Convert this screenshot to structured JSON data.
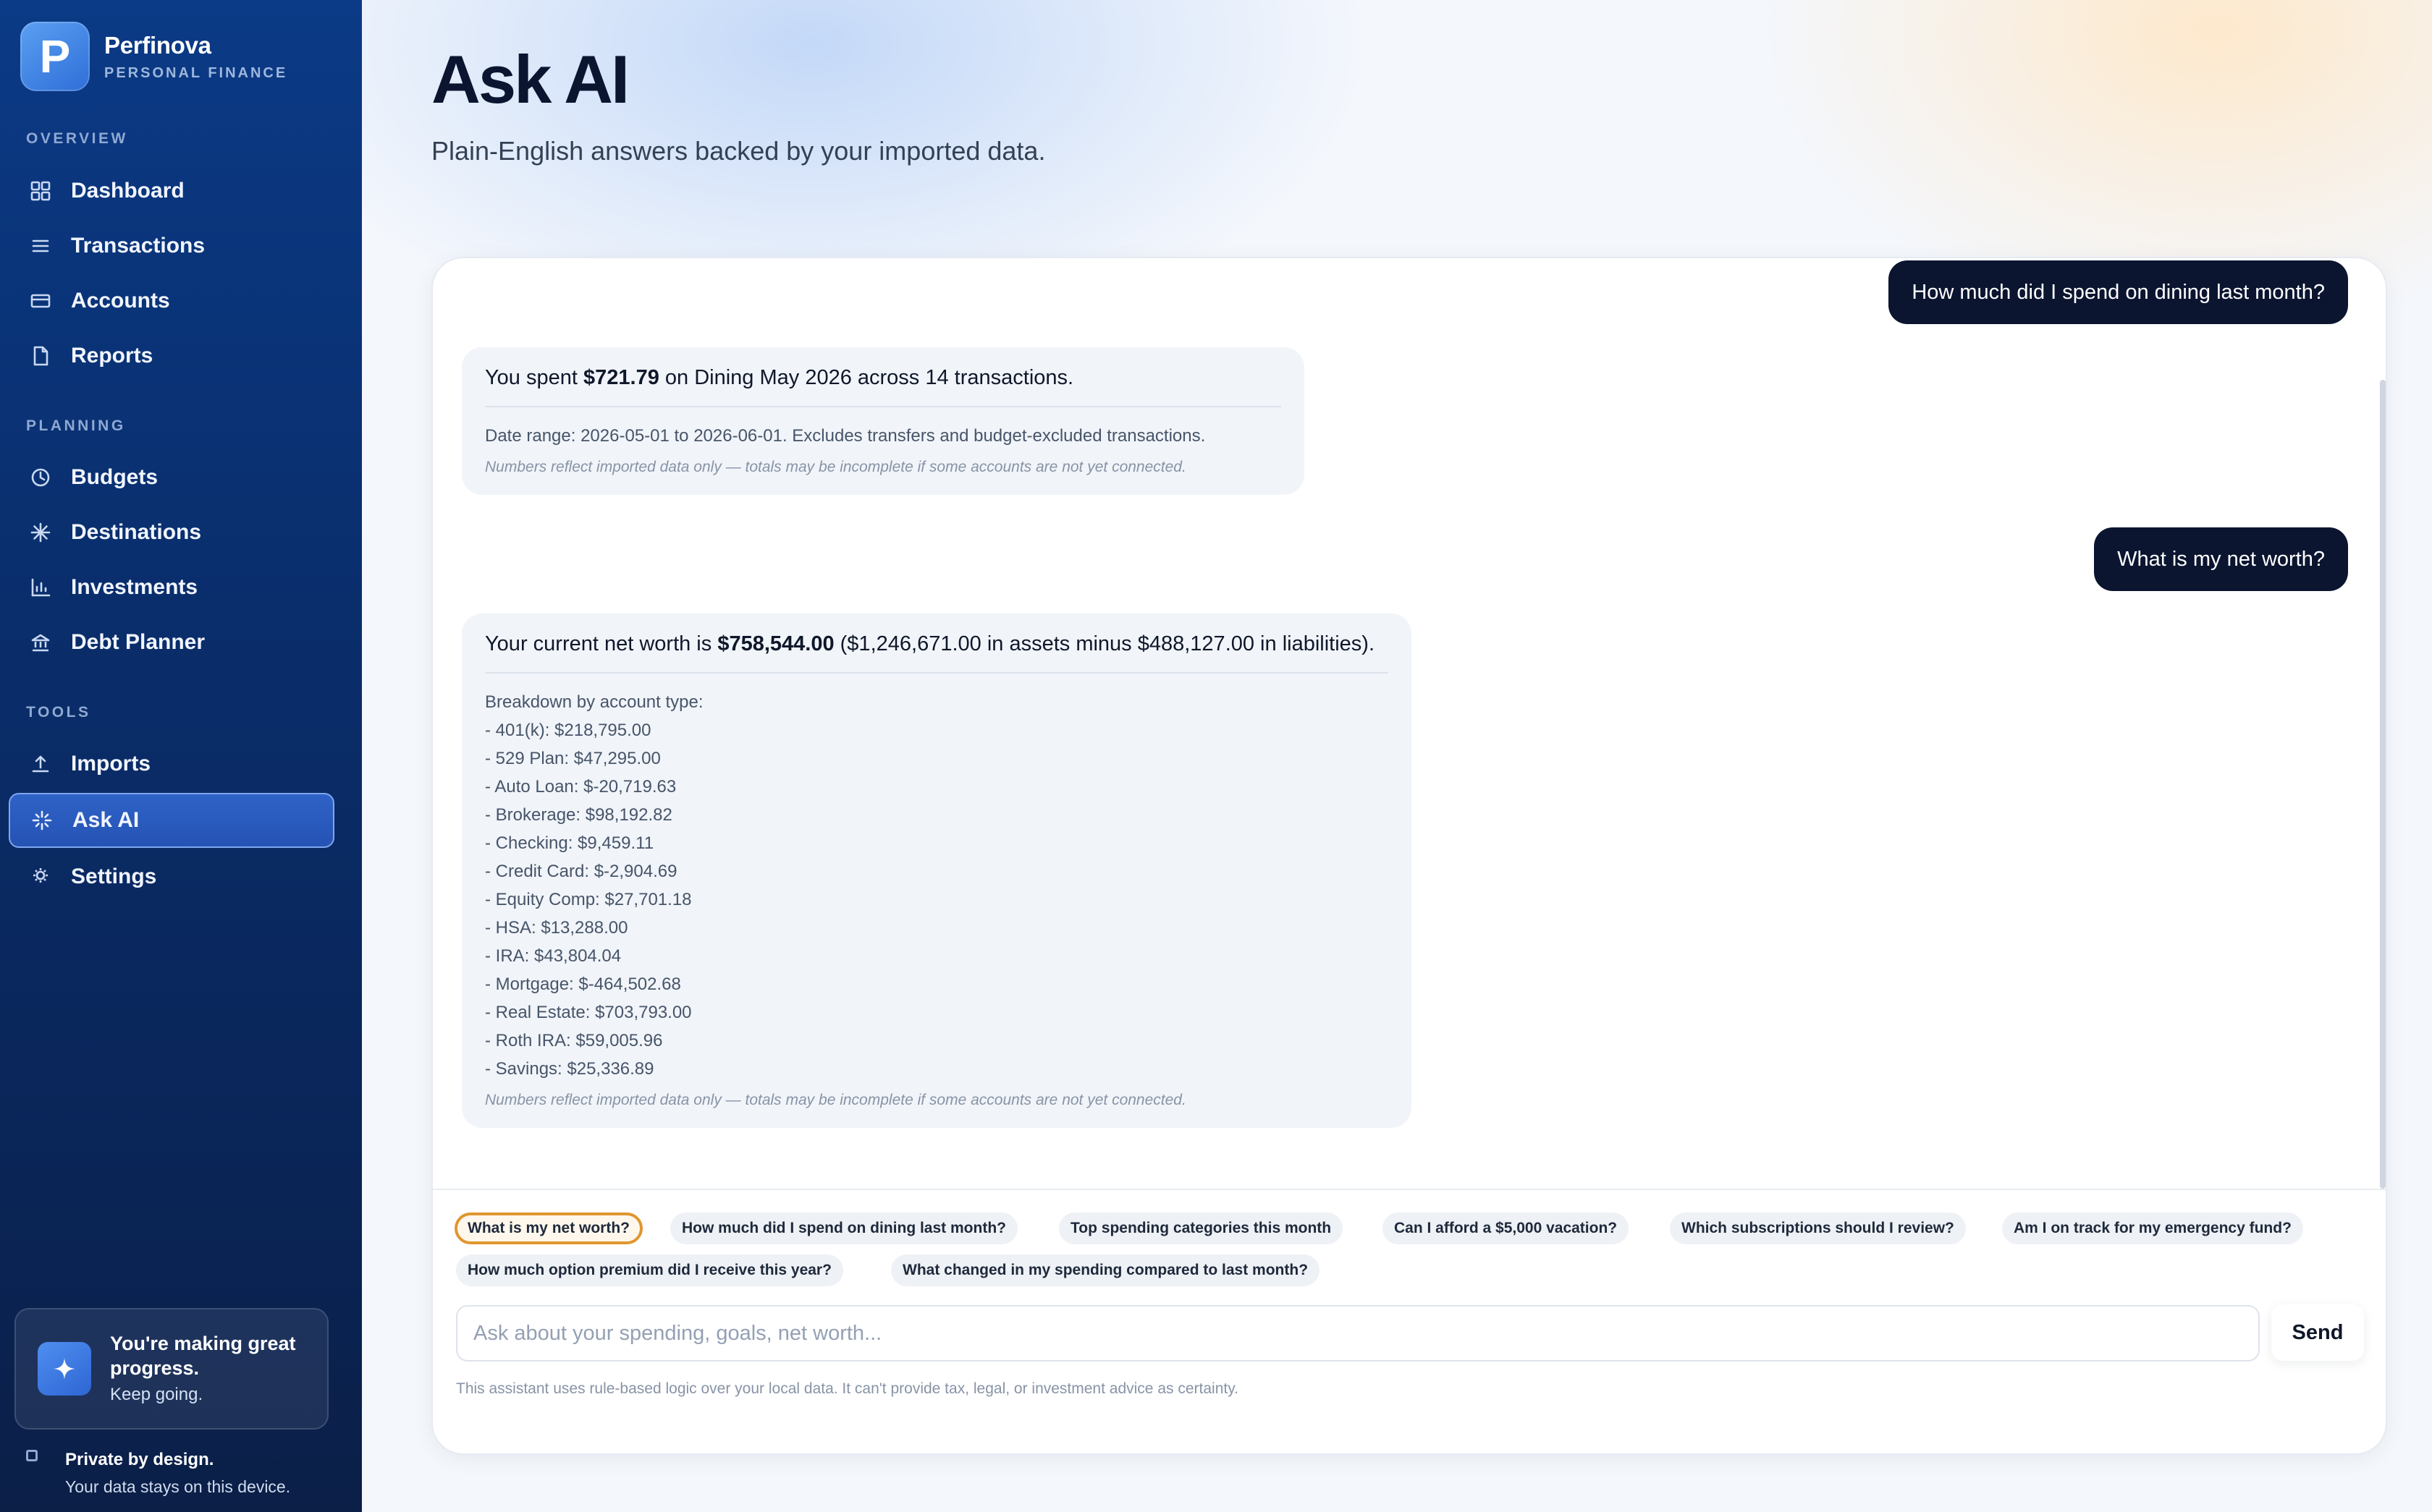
{
  "brand": {
    "name": "Perfinova",
    "subtitle": "PERSONAL FINANCE",
    "logo_letter": "P"
  },
  "sidebar": {
    "sections": [
      {
        "label": "OVERVIEW"
      },
      {
        "label": "PLANNING"
      },
      {
        "label": "TOOLS"
      }
    ],
    "items": [
      {
        "label": "Dashboard",
        "icon": "grid-icon"
      },
      {
        "label": "Transactions",
        "icon": "list-icon"
      },
      {
        "label": "Accounts",
        "icon": "card-icon"
      },
      {
        "label": "Reports",
        "icon": "document-icon"
      },
      {
        "label": "Budgets",
        "icon": "clock-icon"
      },
      {
        "label": "Destinations",
        "icon": "asterisk-icon"
      },
      {
        "label": "Investments",
        "icon": "bar-chart-icon"
      },
      {
        "label": "Debt Planner",
        "icon": "bank-icon"
      },
      {
        "label": "Imports",
        "icon": "upload-icon"
      },
      {
        "label": "Ask AI",
        "icon": "sparkle-icon",
        "active": true
      },
      {
        "label": "Settings",
        "icon": "gear-icon"
      }
    ],
    "promo": {
      "title": "You're making great progress.",
      "subtitle": "Keep going."
    },
    "privacy": {
      "title": "Private by design.",
      "subtitle": "Your data stays on this device."
    }
  },
  "page": {
    "title": "Ask AI",
    "subtitle": "Plain-English answers backed by your imported data."
  },
  "chat": {
    "messages": [
      {
        "role": "user",
        "text": "How much did I spend on dining last month?"
      },
      {
        "role": "assistant",
        "pre": "You spent ",
        "strong": "$721.79",
        "post": " on Dining May 2026 across 14 transactions.",
        "detail": "Date range: 2026-05-01 to 2026-06-01. Excludes transfers and budget-excluded transactions.",
        "note": "Numbers reflect imported data only — totals may be incomplete if some accounts are not yet connected."
      },
      {
        "role": "user",
        "text": "What is my net worth?"
      },
      {
        "role": "assistant",
        "pre": "Your current net worth is ",
        "strong": "$758,544.00",
        "post": " ($1,246,671.00 in assets minus $488,127.00 in liabilities).",
        "detail": "Breakdown by account type:\n- 401(k): $218,795.00\n- 529 Plan: $47,295.00\n- Auto Loan: $-20,719.63\n- Brokerage: $98,192.82\n- Checking: $9,459.11\n- Credit Card: $-2,904.69\n- Equity Comp: $27,701.18\n- HSA: $13,288.00\n- IRA: $43,804.04\n- Mortgage: $-464,502.68\n- Real Estate: $703,793.00\n- Roth IRA: $59,005.96\n- Savings: $25,336.89",
        "note": "Numbers reflect imported data only — totals may be incomplete if some accounts are not yet connected."
      }
    ]
  },
  "suggestions": [
    {
      "label": "What is my net worth?",
      "selected": true
    },
    {
      "label": "How much did I spend on dining last month?"
    },
    {
      "label": "Top spending categories this month"
    },
    {
      "label": "Can I afford a $5,000 vacation?"
    },
    {
      "label": "Which subscriptions should I review?"
    },
    {
      "label": "Am I on track for my emergency fund?"
    },
    {
      "label": "How much option premium did I receive this year?"
    },
    {
      "label": "What changed in my spending compared to last month?"
    }
  ],
  "composer": {
    "placeholder": "Ask about your spending, goals, net worth...",
    "value": "",
    "send_label": "Send",
    "disclaimer": "This assistant uses rule-based logic over your local data. It can't provide tax, legal, or investment advice as certainty."
  },
  "colors": {
    "accent": "#2553b4",
    "chip_selected_border": "#e0962f",
    "user_bubble": "#0b1530"
  }
}
